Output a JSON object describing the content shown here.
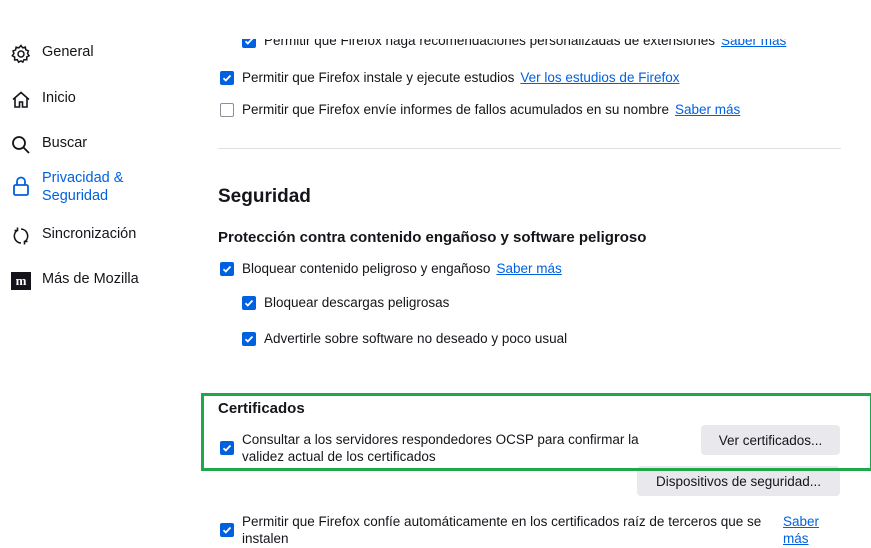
{
  "sidebar": {
    "items": [
      {
        "label": "General",
        "icon": "gear-icon"
      },
      {
        "label": "Inicio",
        "icon": "home-icon"
      },
      {
        "label": "Buscar",
        "icon": "search-icon"
      },
      {
        "label": "Privacidad & Seguridad",
        "icon": "lock-icon",
        "active": true
      },
      {
        "label": "Sincronización",
        "icon": "sync-icon"
      },
      {
        "label": "Más de Mozilla",
        "icon": "mozilla-icon"
      }
    ]
  },
  "data_collection": {
    "recommendations": {
      "label": "Permitir que Firefox haga recomendaciones personalizadas de extensiones",
      "link": "Saber más",
      "checked": true
    },
    "studies": {
      "label": "Permitir que Firefox instale y ejecute estudios",
      "link": "Ver los estudios de Firefox",
      "checked": true
    },
    "crash_reports": {
      "label": "Permitir que Firefox envíe informes de fallos acumulados en su nombre",
      "link": "Saber más",
      "checked": false
    }
  },
  "security": {
    "heading": "Seguridad",
    "protection_heading": "Protección contra contenido engañoso y software peligroso",
    "block_dangerous": {
      "label": "Bloquear contenido peligroso y engañoso",
      "link": "Saber más",
      "checked": true
    },
    "block_downloads": {
      "label": "Bloquear descargas peligrosas",
      "checked": true
    },
    "warn_unwanted": {
      "label": "Advertirle sobre software no deseado y poco usual",
      "checked": true
    }
  },
  "certificates": {
    "heading": "Certificados",
    "ocsp": {
      "label": "Consultar a los servidores respondedores OCSP para confirmar la validez actual de los certificados",
      "checked": true
    },
    "view_button": "Ver certificados...",
    "devices_button": "Dispositivos de seguridad...",
    "third_party": {
      "label": "Permitir que Firefox confíe automáticamente en los certificados raíz de terceros que se instalen",
      "link": "Saber más",
      "checked": true
    }
  },
  "colors": {
    "accent": "#0061e0",
    "highlight": "#1fa84a"
  }
}
